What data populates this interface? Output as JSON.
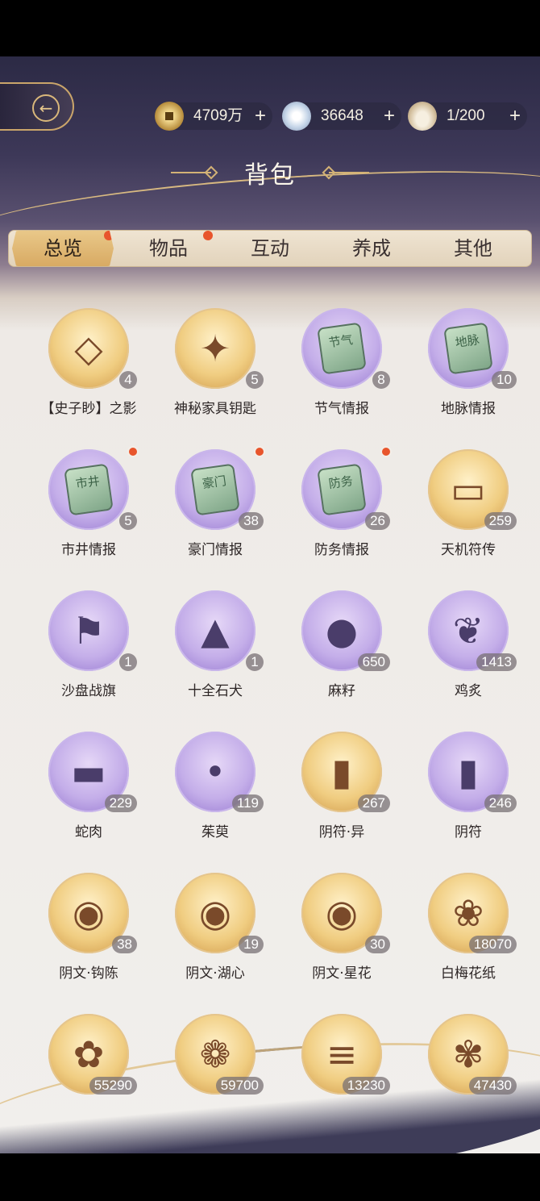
{
  "header": {
    "title": "背包",
    "back_icon": "back-arrow-icon"
  },
  "resources": [
    {
      "name": "coin",
      "icon": "copper-coin-icon",
      "value": "4709万",
      "plus": "+"
    },
    {
      "name": "jade",
      "icon": "jade-orb-icon",
      "value": "36648",
      "plus": "+"
    },
    {
      "name": "bowl",
      "icon": "bowl-icon",
      "value": "1/200",
      "plus": "+"
    }
  ],
  "tabs": [
    {
      "label": "总览",
      "active": true,
      "has_dot": true
    },
    {
      "label": "物品",
      "active": false,
      "has_dot": true
    },
    {
      "label": "互动",
      "active": false,
      "has_dot": false
    },
    {
      "label": "养成",
      "active": false,
      "has_dot": false
    },
    {
      "label": "其他",
      "active": false,
      "has_dot": false
    }
  ],
  "items": [
    {
      "name": "【史子眇】之影",
      "count": "4",
      "bg": "gold",
      "icon": "portrait-crystal-icon",
      "new": false
    },
    {
      "name": "神秘家具钥匙",
      "count": "5",
      "bg": "gold",
      "icon": "branch-key-icon",
      "new": false
    },
    {
      "name": "节气情报",
      "count": "8",
      "bg": "purple",
      "icon": "jade-tablet-icon",
      "tablet_text": "节气",
      "new": false
    },
    {
      "name": "地脉情报",
      "count": "10",
      "bg": "purple",
      "icon": "jade-tablet-icon",
      "tablet_text": "地脉",
      "new": false
    },
    {
      "name": "市井情报",
      "count": "5",
      "bg": "purple",
      "icon": "jade-tablet-icon",
      "tablet_text": "市井",
      "new": true
    },
    {
      "name": "豪门情报",
      "count": "38",
      "bg": "purple",
      "icon": "jade-tablet-icon",
      "tablet_text": "豪门",
      "new": true
    },
    {
      "name": "防务情报",
      "count": "26",
      "bg": "purple",
      "icon": "jade-tablet-icon",
      "tablet_text": "防务",
      "new": true
    },
    {
      "name": "天机符传",
      "count": "259",
      "bg": "gold",
      "icon": "talisman-plaque-icon",
      "new": false
    },
    {
      "name": "沙盘战旗",
      "count": "1",
      "bg": "purple",
      "icon": "war-banner-icon",
      "new": false
    },
    {
      "name": "十全石犬",
      "count": "1",
      "bg": "purple",
      "icon": "stone-dog-icon",
      "new": false
    },
    {
      "name": "麻籽",
      "count": "650",
      "bg": "purple",
      "icon": "seed-bowl-icon",
      "new": false
    },
    {
      "name": "鸡炙",
      "count": "1413",
      "bg": "purple",
      "icon": "cloth-bundle-icon",
      "new": false
    },
    {
      "name": "蛇肉",
      "count": "229",
      "bg": "purple",
      "icon": "meat-icon",
      "new": false
    },
    {
      "name": "茱萸",
      "count": "119",
      "bg": "purple",
      "icon": "berry-branch-icon",
      "new": false
    },
    {
      "name": "阴符·异",
      "count": "267",
      "bg": "gold",
      "icon": "scroll-icon",
      "new": false
    },
    {
      "name": "阴符",
      "count": "246",
      "bg": "purple",
      "icon": "scroll-icon",
      "new": false
    },
    {
      "name": "阴文·钩陈",
      "count": "38",
      "bg": "gold",
      "icon": "scroll-case-icon",
      "new": false
    },
    {
      "name": "阴文·湖心",
      "count": "19",
      "bg": "gold",
      "icon": "scroll-case-icon",
      "new": false
    },
    {
      "name": "阴文·星花",
      "count": "30",
      "bg": "gold",
      "icon": "scroll-case-icon",
      "new": false
    },
    {
      "name": "白梅花纸",
      "count": "18070",
      "bg": "gold",
      "icon": "plum-blossom-icon",
      "new": false
    },
    {
      "name": "",
      "count": "55290",
      "bg": "gold",
      "icon": "white-flower-icon",
      "new": false
    },
    {
      "name": "",
      "count": "59700",
      "bg": "gold",
      "icon": "flower-cushion-icon",
      "new": false
    },
    {
      "name": "",
      "count": "13230",
      "bg": "gold",
      "icon": "bamboo-scroll-icon",
      "new": false
    },
    {
      "name": "",
      "count": "47430",
      "bg": "gold",
      "icon": "flower-plate-icon",
      "new": false
    }
  ],
  "colors": {
    "accent_gold": "#d8aa63",
    "notify_red": "#e8552c",
    "card_purple": "#a488d8",
    "card_gold": "#f0cd81"
  }
}
